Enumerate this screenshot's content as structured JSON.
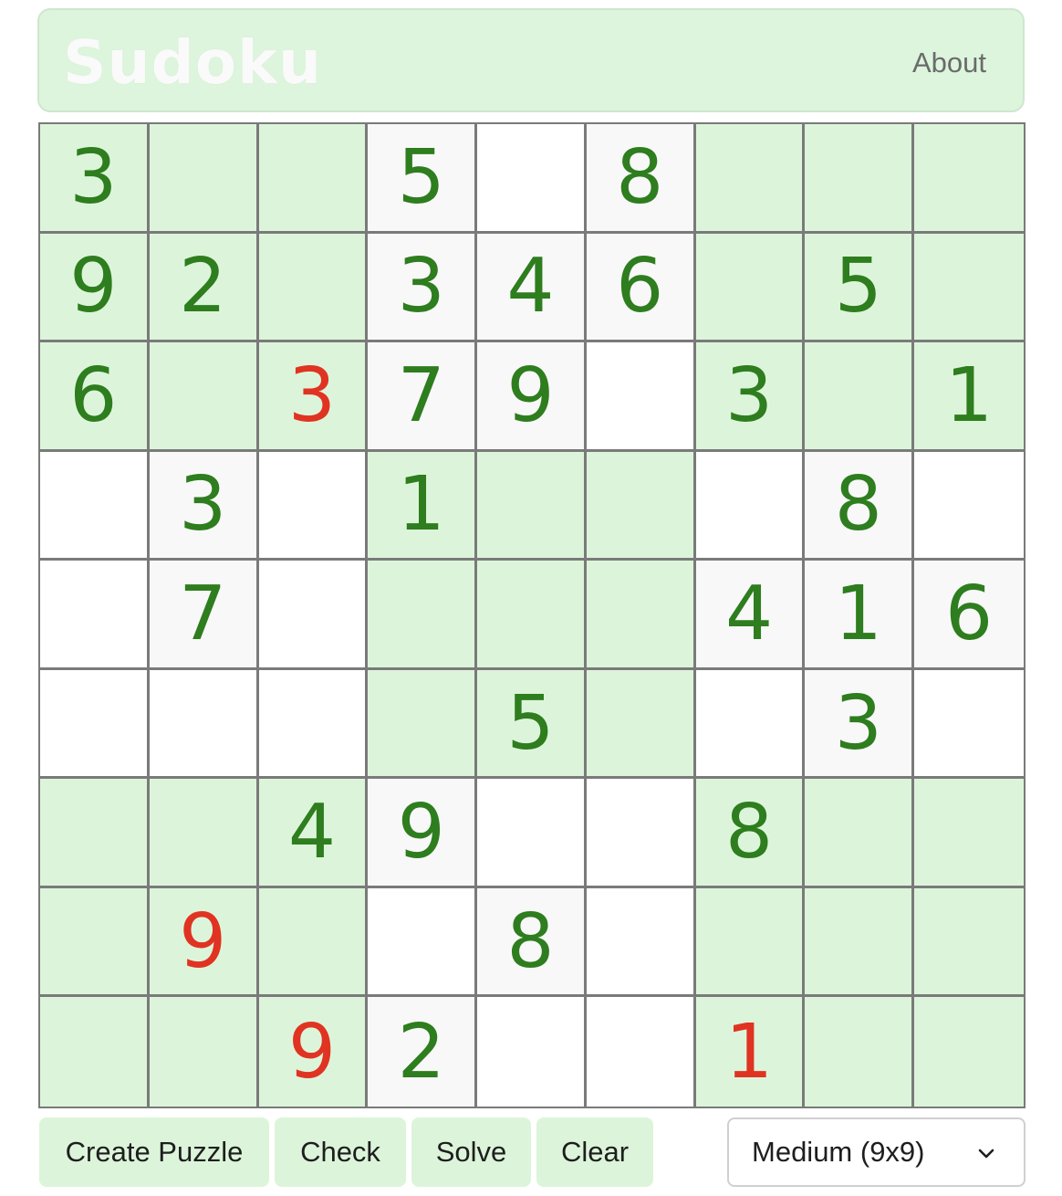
{
  "header": {
    "title": "Sudoku",
    "about_label": "About"
  },
  "board": {
    "size": 9,
    "cells": [
      [
        {
          "v": "3",
          "bg": "green"
        },
        {
          "v": "",
          "bg": "green"
        },
        {
          "v": "",
          "bg": "green"
        },
        {
          "v": "5",
          "bg": "grey"
        },
        {
          "v": "",
          "bg": "white"
        },
        {
          "v": "8",
          "bg": "grey"
        },
        {
          "v": "",
          "bg": "green"
        },
        {
          "v": "",
          "bg": "green"
        },
        {
          "v": "",
          "bg": "green"
        }
      ],
      [
        {
          "v": "9",
          "bg": "green"
        },
        {
          "v": "2",
          "bg": "green"
        },
        {
          "v": "",
          "bg": "green"
        },
        {
          "v": "3",
          "bg": "grey"
        },
        {
          "v": "4",
          "bg": "grey"
        },
        {
          "v": "6",
          "bg": "grey"
        },
        {
          "v": "",
          "bg": "green"
        },
        {
          "v": "5",
          "bg": "green"
        },
        {
          "v": "",
          "bg": "green"
        }
      ],
      [
        {
          "v": "6",
          "bg": "green"
        },
        {
          "v": "",
          "bg": "green"
        },
        {
          "v": "3",
          "bg": "green",
          "error": true
        },
        {
          "v": "7",
          "bg": "grey"
        },
        {
          "v": "9",
          "bg": "grey"
        },
        {
          "v": "",
          "bg": "white"
        },
        {
          "v": "3",
          "bg": "green"
        },
        {
          "v": "",
          "bg": "green"
        },
        {
          "v": "1",
          "bg": "green"
        }
      ],
      [
        {
          "v": "",
          "bg": "white"
        },
        {
          "v": "3",
          "bg": "grey"
        },
        {
          "v": "",
          "bg": "white"
        },
        {
          "v": "1",
          "bg": "green"
        },
        {
          "v": "",
          "bg": "green"
        },
        {
          "v": "",
          "bg": "green"
        },
        {
          "v": "",
          "bg": "white"
        },
        {
          "v": "8",
          "bg": "grey"
        },
        {
          "v": "",
          "bg": "white"
        }
      ],
      [
        {
          "v": "",
          "bg": "white"
        },
        {
          "v": "7",
          "bg": "grey"
        },
        {
          "v": "",
          "bg": "white"
        },
        {
          "v": "",
          "bg": "green"
        },
        {
          "v": "",
          "bg": "green"
        },
        {
          "v": "",
          "bg": "green"
        },
        {
          "v": "4",
          "bg": "grey"
        },
        {
          "v": "1",
          "bg": "grey"
        },
        {
          "v": "6",
          "bg": "grey"
        }
      ],
      [
        {
          "v": "",
          "bg": "white"
        },
        {
          "v": "",
          "bg": "white"
        },
        {
          "v": "",
          "bg": "white"
        },
        {
          "v": "",
          "bg": "green"
        },
        {
          "v": "5",
          "bg": "green"
        },
        {
          "v": "",
          "bg": "green"
        },
        {
          "v": "",
          "bg": "white"
        },
        {
          "v": "3",
          "bg": "grey"
        },
        {
          "v": "",
          "bg": "white"
        }
      ],
      [
        {
          "v": "",
          "bg": "green"
        },
        {
          "v": "",
          "bg": "green"
        },
        {
          "v": "4",
          "bg": "green"
        },
        {
          "v": "9",
          "bg": "grey"
        },
        {
          "v": "",
          "bg": "white"
        },
        {
          "v": "",
          "bg": "white"
        },
        {
          "v": "8",
          "bg": "green"
        },
        {
          "v": "",
          "bg": "green"
        },
        {
          "v": "",
          "bg": "green"
        }
      ],
      [
        {
          "v": "",
          "bg": "green"
        },
        {
          "v": "9",
          "bg": "green",
          "error": true
        },
        {
          "v": "",
          "bg": "green"
        },
        {
          "v": "",
          "bg": "white"
        },
        {
          "v": "8",
          "bg": "grey"
        },
        {
          "v": "",
          "bg": "white"
        },
        {
          "v": "",
          "bg": "green"
        },
        {
          "v": "",
          "bg": "green"
        },
        {
          "v": "",
          "bg": "green"
        }
      ],
      [
        {
          "v": "",
          "bg": "green"
        },
        {
          "v": "",
          "bg": "green"
        },
        {
          "v": "9",
          "bg": "green",
          "error": true
        },
        {
          "v": "2",
          "bg": "grey"
        },
        {
          "v": "",
          "bg": "white"
        },
        {
          "v": "",
          "bg": "white"
        },
        {
          "v": "1",
          "bg": "green",
          "error": true
        },
        {
          "v": "",
          "bg": "green"
        },
        {
          "v": "",
          "bg": "green"
        }
      ]
    ]
  },
  "controls": {
    "create_label": "Create Puzzle",
    "check_label": "Check",
    "solve_label": "Solve",
    "clear_label": "Clear",
    "difficulty_selected": "Medium (9x9)"
  },
  "colors": {
    "accent": "#dcf5da",
    "digit": "#2e7d1e",
    "error_digit": "#e03322",
    "grid_line": "#7a7a7a"
  }
}
